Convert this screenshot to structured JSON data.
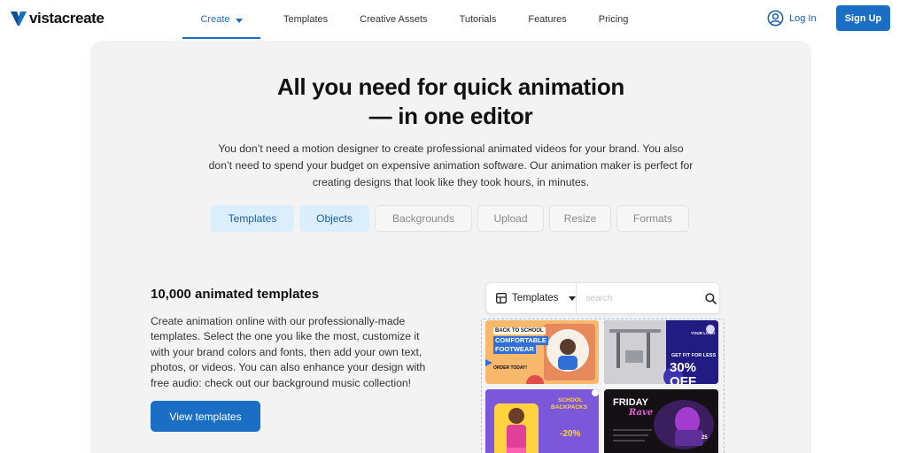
{
  "brand": {
    "name": "vistacreate",
    "accent": "#1a6fc4"
  },
  "nav": {
    "items": [
      "Create",
      "Templates",
      "Creative Assets",
      "Tutorials",
      "Features",
      "Pricing"
    ],
    "active_index": 0
  },
  "auth": {
    "login_label": "Log In",
    "signup_label": "Sign Up"
  },
  "hero": {
    "title": "All you need for quick animation — in one editor",
    "description": "You don’t need a motion designer to create professional animated videos for your brand. You also don’t need to spend your budget on expensive animation software. Our animation maker is perfect for creating designs that look like they took hours, in minutes."
  },
  "tabs": [
    {
      "label": "Templates",
      "active": true
    },
    {
      "label": "Objects",
      "active": true
    },
    {
      "label": "Backgrounds",
      "active": false
    },
    {
      "label": "Upload",
      "active": false
    },
    {
      "label": "Resize",
      "active": false
    },
    {
      "label": "Formats",
      "active": false
    }
  ],
  "section": {
    "title": "10,000 animated templates",
    "description": "Create animation online with our professionally-made templates. Select the one you like the most, customize it with your brand colors and fonts, then add your own text, photos, or videos. You can also enhance your design with free audio: check out our background music collection!",
    "button_label": "View templates"
  },
  "widget": {
    "select_label": "Templates",
    "search_placeholder": "search"
  },
  "thumbnails": {
    "t1": {
      "line1": "BACK TO SCHOOL",
      "line2": "COMFORTABLE",
      "line3": "FOOTWEAR",
      "line4": "ORDER TODAY!"
    },
    "t2": {
      "logo": "YOUR LOGO",
      "line1": "GET FIT FOR LESS",
      "line2": "30% OFF"
    },
    "t3": {
      "line1": "SCHOOL",
      "line2": "BACKPACKS",
      "line3": "-20%"
    },
    "t4": {
      "line1": "FRIDAY",
      "line2": "Rave",
      "line3": "25"
    }
  }
}
